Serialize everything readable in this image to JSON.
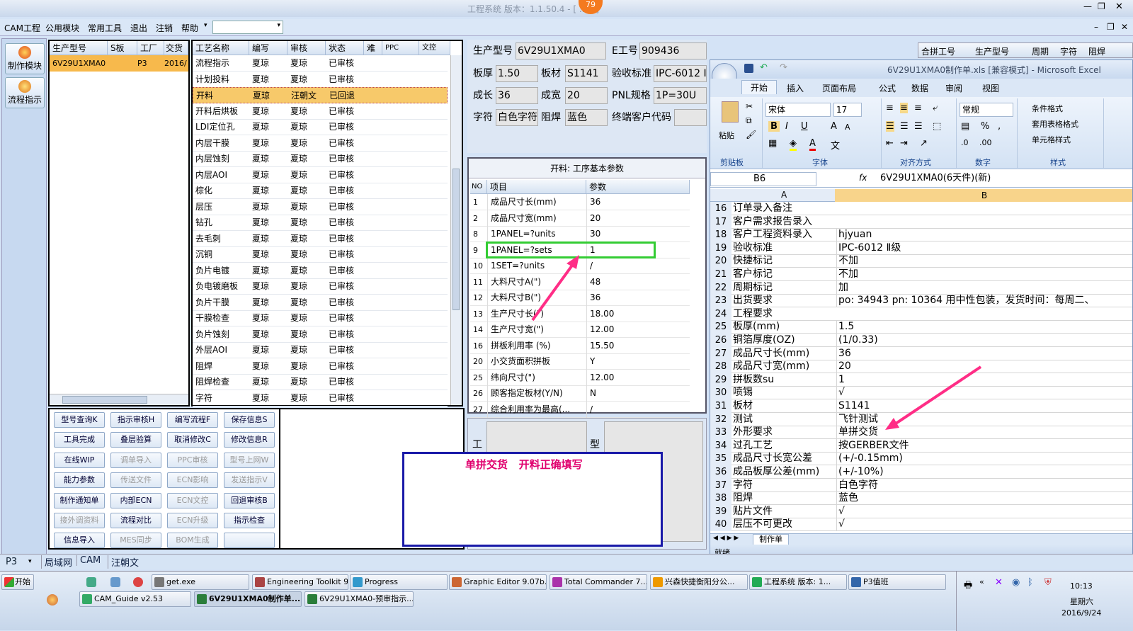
{
  "window": {
    "title": "工程系统  版本：1.1.50.4 - [ ...示]",
    "badge": "79"
  },
  "menu": [
    "CAM工程",
    "公用模块",
    "常用工具",
    "退出",
    "注销",
    "帮助"
  ],
  "side": [
    {
      "label": "制作模块"
    },
    {
      "label": "流程指示"
    }
  ],
  "model_list": {
    "headers": [
      "生产型号",
      "S板",
      "工厂",
      "交货E"
    ],
    "rows": [
      [
        "6V29U1XMA0",
        "",
        "P3",
        "2016/"
      ]
    ]
  },
  "proc": {
    "headers": [
      "工艺名称",
      "编写",
      "审核",
      "状态",
      "难",
      "PPC",
      "文控"
    ],
    "rows": [
      [
        "流程指示",
        "夏琼",
        "夏琼",
        "已审核"
      ],
      [
        "计划投料",
        "夏琼",
        "夏琼",
        "已审核"
      ],
      [
        "开料",
        "夏琼",
        "汪朝文",
        "已回退"
      ],
      [
        "开料后烘板",
        "夏琼",
        "夏琼",
        "已审核"
      ],
      [
        "LDI定位孔",
        "夏琼",
        "夏琼",
        "已审核"
      ],
      [
        "内层干膜",
        "夏琼",
        "夏琼",
        "已审核"
      ],
      [
        "内层蚀刻",
        "夏琼",
        "夏琼",
        "已审核"
      ],
      [
        "内层AOI",
        "夏琼",
        "夏琼",
        "已审核"
      ],
      [
        "棕化",
        "夏琼",
        "夏琼",
        "已审核"
      ],
      [
        "层压",
        "夏琼",
        "夏琼",
        "已审核"
      ],
      [
        "钻孔",
        "夏琼",
        "夏琼",
        "已审核"
      ],
      [
        "去毛刺",
        "夏琼",
        "夏琼",
        "已审核"
      ],
      [
        "沉铜",
        "夏琼",
        "夏琼",
        "已审核"
      ],
      [
        "负片电镀",
        "夏琼",
        "夏琼",
        "已审核"
      ],
      [
        "负电镀磨板",
        "夏琼",
        "夏琼",
        "已审核"
      ],
      [
        "负片干膜",
        "夏琼",
        "夏琼",
        "已审核"
      ],
      [
        "干膜检查",
        "夏琼",
        "夏琼",
        "已审核"
      ],
      [
        "负片蚀刻",
        "夏琼",
        "夏琼",
        "已审核"
      ],
      [
        "外层AOI",
        "夏琼",
        "夏琼",
        "已审核"
      ],
      [
        "阻焊",
        "夏琼",
        "夏琼",
        "已审核"
      ],
      [
        "阻焊检查",
        "夏琼",
        "夏琼",
        "已审核"
      ],
      [
        "字符",
        "夏琼",
        "夏琼",
        "已审核"
      ]
    ]
  },
  "buttons": [
    "型号查询K",
    "指示审核H",
    "编写流程F",
    "保存信息S",
    "工具完成",
    "叠层验算",
    "取消修改C",
    "修改信息R",
    "在线WIP",
    "调单导入",
    "PPC审核",
    "型号上网W",
    "能力参数",
    "传送文件",
    "ECN影响",
    "发送指示V",
    "制作通知单",
    "内部ECN",
    "ECN文控",
    "回退审核B",
    "接外调资料",
    "流程对比",
    "ECN升级",
    "指示检查",
    "信息导入",
    "MES同步",
    "BOM生成",
    ""
  ],
  "annotation": "单拼交货   开料正确填写",
  "form": {
    "prod_label": "生产型号",
    "prod": "6V29U1XMA0",
    "e_label": "E工号",
    "e": "909436",
    "thick_label": "板厚",
    "thick": "1.50",
    "mat_label": "板材",
    "mat": "S1141",
    "std_label": "验收标准",
    "std": "IPC-6012 I",
    "len_label": "成长",
    "len": "36",
    "wid_label": "成宽",
    "wid": "20",
    "pnl_label": "PNL规格",
    "pnl": "1P=30U",
    "char_label": "字符",
    "char": "白色字符",
    "mask_label": "阻焊",
    "mask": "蓝色",
    "cust_label": "终端客户代码",
    "cust": ""
  },
  "params": {
    "title": "开料: 工序基本参数",
    "headers": [
      "NO",
      "项目",
      "参数"
    ],
    "rows": [
      [
        "1",
        "成品尺寸长(mm)",
        "36"
      ],
      [
        "2",
        "成品尺寸宽(mm)",
        "20"
      ],
      [
        "8",
        "1PANEL=?units",
        "30"
      ],
      [
        "9",
        "1PANEL=?sets",
        "1"
      ],
      [
        "10",
        "1SET=?units",
        "/"
      ],
      [
        "11",
        "大料尺寸A(\")",
        "48"
      ],
      [
        "12",
        "大料尺寸B(\")",
        "36"
      ],
      [
        "13",
        "生产尺寸长(\")",
        "18.00"
      ],
      [
        "14",
        "生产尺寸宽(\")",
        "12.00"
      ],
      [
        "16",
        "拼板利用率 (%)",
        "15.50"
      ],
      [
        "20",
        "小交货面积拼板",
        "Y"
      ],
      [
        "25",
        "纬向尺寸(\")",
        "12.00"
      ],
      [
        "26",
        "顾客指定板材(Y/N)",
        "N"
      ],
      [
        "27",
        "综合利用率为最高(...",
        "/"
      ]
    ]
  },
  "lower": {
    "left": "工",
    "right": "型"
  },
  "right_headers": [
    "合拼工号",
    "生产型号",
    "周期",
    "字符",
    "阻焊"
  ],
  "excel": {
    "title": "6V29U1XMA0制作单.xls [兼容模式] - Microsoft Excel",
    "tabs": [
      "开始",
      "插入",
      "页面布局",
      "公式",
      "数据",
      "审阅",
      "视图"
    ],
    "font": "宋体",
    "size": "17",
    "numfmt": "常规",
    "groups": [
      "剪贴板",
      "字体",
      "对齐方式",
      "数字",
      "样式"
    ],
    "styles": [
      "条件格式",
      "套用表格格式",
      "单元格样式"
    ],
    "paste": "粘贴",
    "namebox": "B6",
    "formula": "6V29U1XMA0(6天件)(新)",
    "colA": "A",
    "colB": "B",
    "sheet": "制作单",
    "status": "就绪",
    "rows": [
      [
        "16",
        "订单录入备注",
        ""
      ],
      [
        "17",
        "客户需求报告录入",
        ""
      ],
      [
        "18",
        "客户工程资料录入",
        "hjyuan"
      ],
      [
        "19",
        "验收标准",
        "IPC-6012 Ⅱ级"
      ],
      [
        "20",
        "快捷标记",
        "不加"
      ],
      [
        "21",
        "客户标记",
        "不加"
      ],
      [
        "22",
        "周期标记",
        "加"
      ],
      [
        "23",
        "出货要求",
        "po: 34943 pn: 10364 用中性包装，发货时间：每周二、"
      ],
      [
        "24",
        "工程要求",
        ""
      ],
      [
        "25",
        "板厚(mm)",
        "1.5"
      ],
      [
        "26",
        "铜箔厚度(OZ)",
        "(1/0.33)"
      ],
      [
        "27",
        "成品尺寸长(mm)",
        "36"
      ],
      [
        "28",
        "成品尺寸宽(mm)",
        "20"
      ],
      [
        "29",
        "拼板数su",
        "1"
      ],
      [
        "30",
        "喷锡",
        "√"
      ],
      [
        "31",
        "板材",
        "S1141"
      ],
      [
        "32",
        "测试",
        "飞针测试"
      ],
      [
        "33",
        "外形要求",
        "单拼交货"
      ],
      [
        "34",
        "过孔工艺",
        "按GERBER文件"
      ],
      [
        "35",
        "成品尺寸长宽公差",
        "(+/-0.15mm)"
      ],
      [
        "36",
        "成品板厚公差(mm)",
        "(+/-10%)"
      ],
      [
        "37",
        "字符",
        "白色字符"
      ],
      [
        "38",
        "阻焊",
        "蓝色"
      ],
      [
        "39",
        "贴片文件",
        "√"
      ],
      [
        "40",
        "层压不可更改",
        "√"
      ]
    ]
  },
  "statusbar": {
    "site": "P3",
    "tabs": [
      "局域网",
      "CAM",
      "汪朝文"
    ]
  },
  "taskbar": {
    "start": "开始",
    "row1": [
      "get.exe",
      "Engineering Toolkit 9...",
      "Progress",
      "Graphic Editor 9.07b...",
      "Total Commander 7....",
      "兴森快捷衡阳分公...",
      "工程系统  版本: 1...",
      "P3值班"
    ],
    "row2": [
      "CAM_Guide v2.53",
      "6V29U1XMA0制作单...",
      "6V29U1XMA0-预审指示..."
    ],
    "time": "10:13",
    "day": "星期六",
    "date": "2016/9/24"
  },
  "colors": {
    "accent": "#ff2d86",
    "highlight_row": "#f7c96a",
    "green_box": "#33cc33",
    "annotation_border": "#1a1aa8",
    "annotation_text": "#e0006e"
  }
}
